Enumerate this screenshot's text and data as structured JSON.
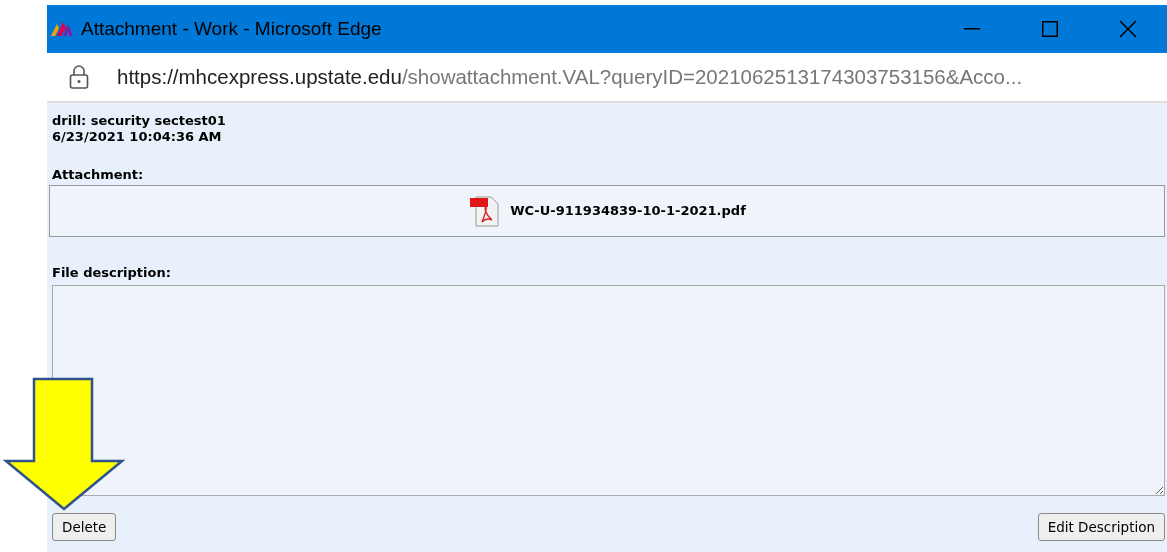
{
  "window": {
    "title": "Attachment - Work - Microsoft Edge"
  },
  "address_bar": {
    "url_host": "https://mhcexpress.upstate.edu",
    "url_rest": "/showattachment.VAL?queryID=2021062513174303753156&Acco..."
  },
  "header": {
    "author": "drill: security sectest01",
    "timestamp": "6/23/2021 10:04:36 AM"
  },
  "attachment": {
    "label": "Attachment:",
    "file_name": "WC-U-911934839-10-1-2021.pdf"
  },
  "description": {
    "label": "File description:"
  },
  "buttons": [
    {
      "label": "Delete",
      "kind": "left"
    },
    {
      "label": "Edit Description",
      "kind": "right"
    }
  ]
}
